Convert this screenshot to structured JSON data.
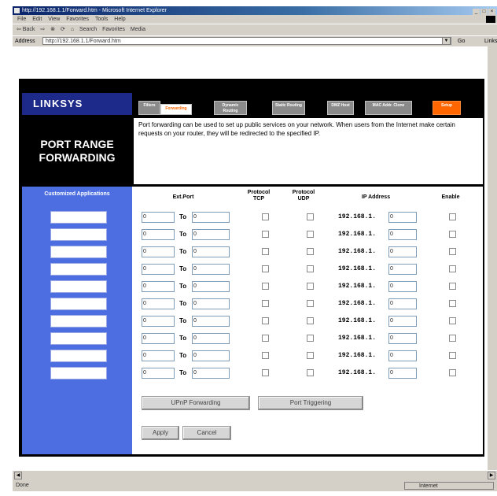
{
  "window": {
    "title": "http://192.168.1.1/Forward.htm - Microsoft Internet Explorer",
    "controls": [
      "_",
      "□",
      "×"
    ]
  },
  "menu": [
    "File",
    "Edit",
    "View",
    "Favorites",
    "Tools",
    "Help"
  ],
  "toolbar": {
    "back": "⇦ Back",
    "forward": "⇨",
    "stop": "⊗",
    "refresh": "⟳",
    "home": "⌂",
    "search": "Search",
    "favorites": "Favorites",
    "media": "Media"
  },
  "address": {
    "label": "Address",
    "url": "http://192.168.1.1/Forward.htm",
    "go": "Go",
    "links": "Links"
  },
  "status": {
    "text": "Done",
    "zone": "Internet"
  },
  "linksys": {
    "logo": "LINKSYS",
    "tabs": [
      {
        "label": "Filters"
      },
      {
        "label": "Forwarding"
      },
      {
        "label": "Dynamic Routing"
      },
      {
        "label": "Static Routing"
      },
      {
        "label": "DMZ Host"
      },
      {
        "label": "MAC Addr. Clone"
      },
      {
        "label": "Setup"
      }
    ],
    "page_title_line1": "PORT RANGE",
    "page_title_line2": "FORWARDING",
    "description": "Port forwarding can be used to set up public services on your network. When users from the Internet make certain requests on your router, they will be redirected to the specified IP.",
    "left_header": "Customized Applications",
    "columns": {
      "ext_port": "Ext.Port",
      "protocol_tcp": "Protocol TCP",
      "protocol_udp": "Protocol UDP",
      "ip_address": "IP Address",
      "enable": "Enable"
    },
    "to_label": "To",
    "ip_prefix": "192.168.1.",
    "port_default": "0",
    "ip_default": "0",
    "rows": 10,
    "buttons": {
      "upnp": "UPnP Forwarding",
      "port_triggering": "Port Triggering",
      "apply": "Apply",
      "cancel": "Cancel"
    }
  }
}
